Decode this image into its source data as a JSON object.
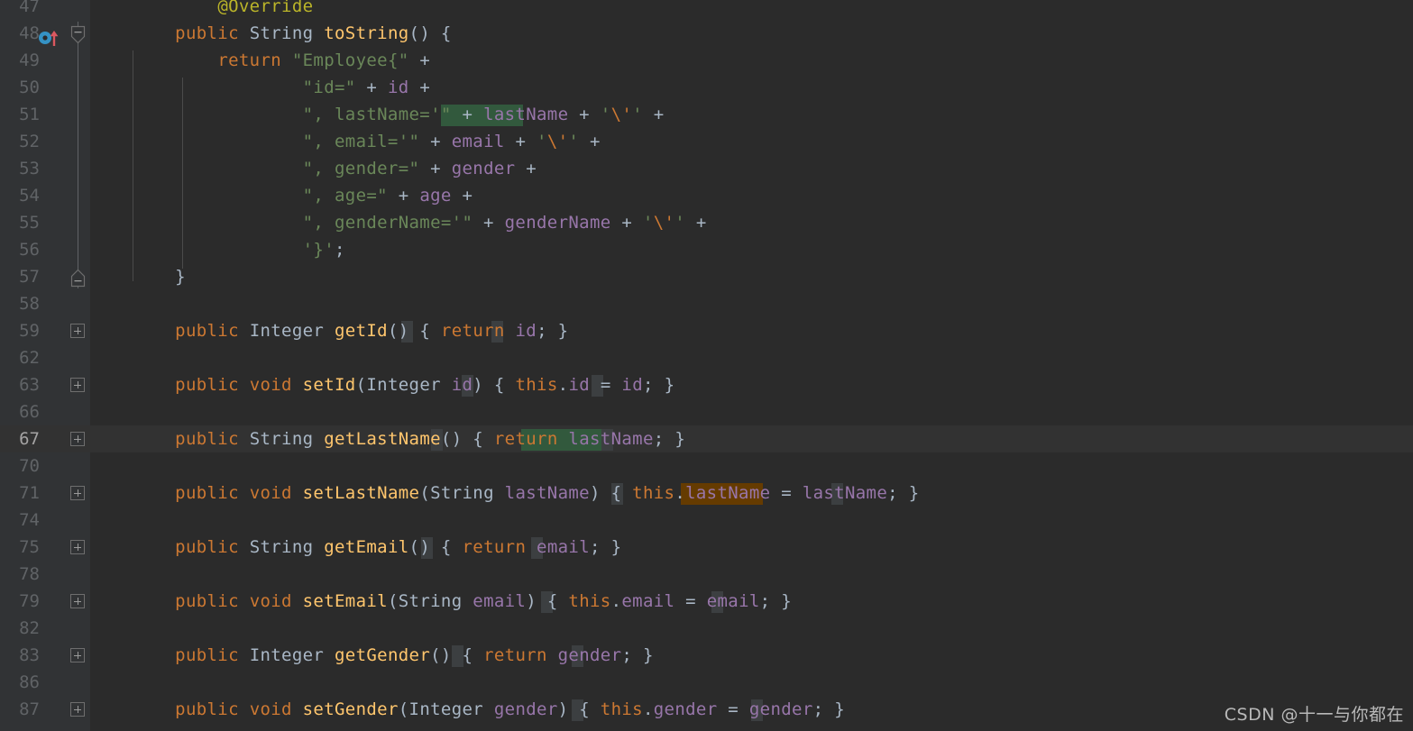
{
  "editor": {
    "theme": "Darcula",
    "background": "#2B2B2B",
    "gutter_background": "#313335",
    "current_line_background": "#323232",
    "line_number_color": "#606366",
    "current_line_number_color": "#A4A3A3",
    "font_size_px": 19,
    "line_height_px": 30,
    "current_line_number": "67",
    "colors": {
      "keyword": "#CC7832",
      "string": "#6A8759",
      "method": "#FFC66D",
      "field": "#9876AA",
      "identifier": "#A9B7C6",
      "annotation": "#BBB529",
      "number": "#6897BB",
      "read_highlight": "#32593D",
      "write_highlight": "#653B00",
      "folded_brace_highlight": "#3C3F41",
      "indent_guide": "#4B4B4B"
    }
  },
  "gutter": {
    "override_icon": {
      "name": "overriding-method-icon",
      "line": "48",
      "tooltip_meaning": "Overrides method in Object",
      "circle_color": "#3592C4",
      "arrow_color": "#DB5860"
    },
    "fold_markers": [
      {
        "line": "48",
        "type": "collapse-top",
        "symbol": "minus"
      },
      {
        "line": "57",
        "type": "collapse-bottom",
        "symbol": "minus"
      },
      {
        "line": "59",
        "type": "expand",
        "symbol": "plus"
      },
      {
        "line": "63",
        "type": "expand",
        "symbol": "plus"
      },
      {
        "line": "67",
        "type": "expand",
        "symbol": "plus"
      },
      {
        "line": "71",
        "type": "expand",
        "symbol": "plus"
      },
      {
        "line": "75",
        "type": "expand",
        "symbol": "plus"
      },
      {
        "line": "79",
        "type": "expand",
        "symbol": "plus"
      },
      {
        "line": "83",
        "type": "expand",
        "symbol": "plus"
      },
      {
        "line": "87",
        "type": "expand",
        "symbol": "plus"
      }
    ]
  },
  "lines": [
    {
      "num": "47",
      "text": "        @Override"
    },
    {
      "num": "48",
      "text": "    public String toString() {"
    },
    {
      "num": "49",
      "text": "        return \"Employee{\" +"
    },
    {
      "num": "50",
      "text": "                \"id=\" + id +"
    },
    {
      "num": "51",
      "text": "                \", lastName='\" + lastName + '\\'' +"
    },
    {
      "num": "52",
      "text": "                \", email='\" + email + '\\'' +"
    },
    {
      "num": "53",
      "text": "                \", gender=\" + gender +"
    },
    {
      "num": "54",
      "text": "                \", age=\" + age +"
    },
    {
      "num": "55",
      "text": "                \", genderName='\" + genderName + '\\'' +"
    },
    {
      "num": "56",
      "text": "                '}';"
    },
    {
      "num": "57",
      "text": "    }"
    },
    {
      "num": "58",
      "text": ""
    },
    {
      "num": "59",
      "text": "    public Integer getId() { return id; }"
    },
    {
      "num": "62",
      "text": ""
    },
    {
      "num": "63",
      "text": "    public void setId(Integer id) { this.id = id; }"
    },
    {
      "num": "66",
      "text": ""
    },
    {
      "num": "67",
      "text": "    public String getLastName() { return lastName; }"
    },
    {
      "num": "70",
      "text": ""
    },
    {
      "num": "71",
      "text": "    public void setLastName(String lastName) { this.lastName = lastName; }"
    },
    {
      "num": "74",
      "text": ""
    },
    {
      "num": "75",
      "text": "    public String getEmail() { return email; }"
    },
    {
      "num": "78",
      "text": ""
    },
    {
      "num": "79",
      "text": "    public void setEmail(String email) { this.email = email; }"
    },
    {
      "num": "82",
      "text": ""
    },
    {
      "num": "83",
      "text": "    public Integer getGender() { return gender; }"
    },
    {
      "num": "86",
      "text": ""
    },
    {
      "num": "87",
      "text": "    public void setGender(Integer gender) { this.gender = gender; }"
    }
  ],
  "watermark": {
    "text": "CSDN @十一与你都在"
  }
}
